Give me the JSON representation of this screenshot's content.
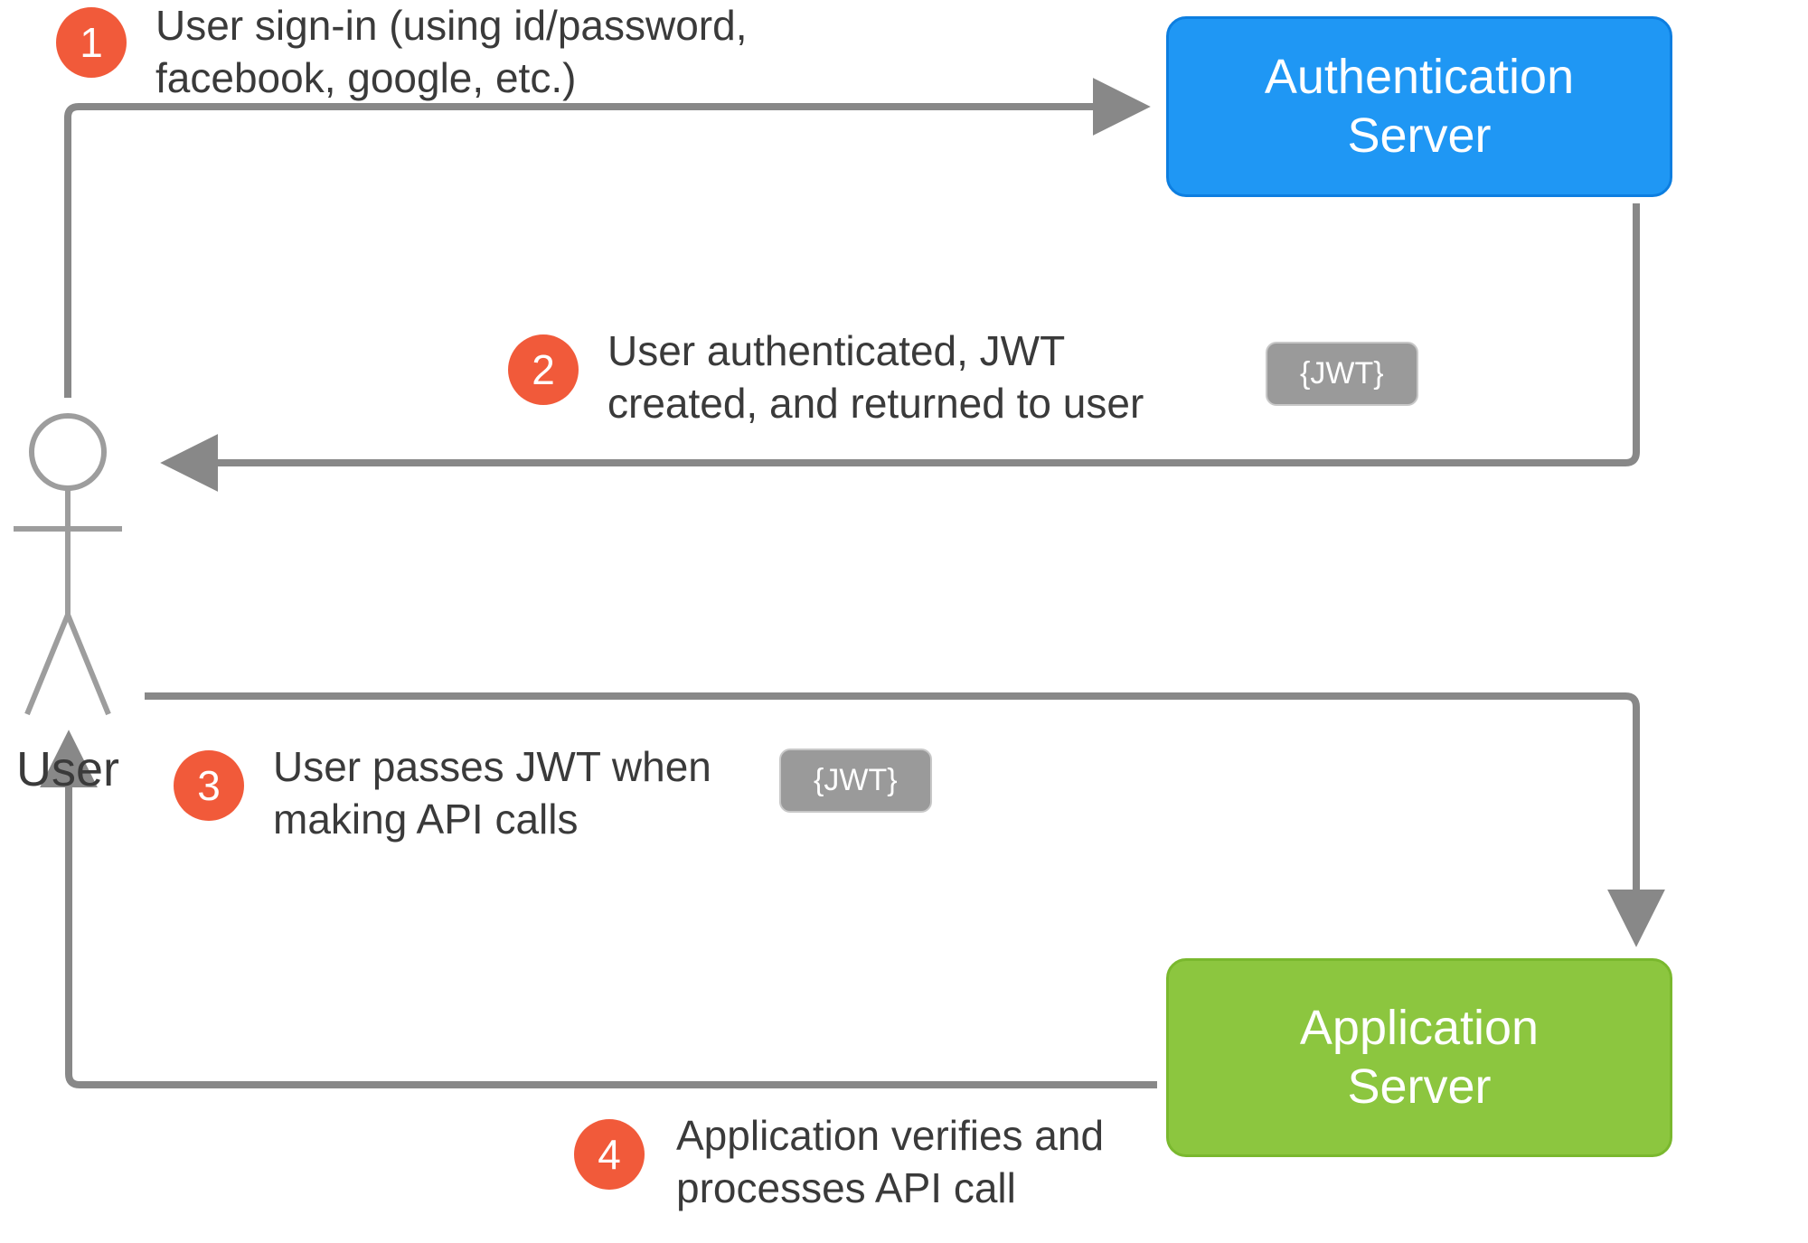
{
  "actors": {
    "user_label": "User"
  },
  "servers": {
    "auth": "Authentication\nServer",
    "app": "Application\nServer"
  },
  "steps": {
    "s1": {
      "num": "1",
      "text": "User sign-in (using id/password,\nfacebook, google, etc.)"
    },
    "s2": {
      "num": "2",
      "text": "User authenticated, JWT\ncreated, and returned to user"
    },
    "s3": {
      "num": "3",
      "text": "User passes JWT when\nmaking API calls"
    },
    "s4": {
      "num": "4",
      "text": "Application verifies and\nprocesses API call"
    }
  },
  "tokens": {
    "jwt_label": "{JWT}"
  },
  "colors": {
    "badge": "#f15a3a",
    "auth_server": "#1f97f4",
    "app_server": "#8cc63f",
    "arrow": "#888888",
    "token_bg": "#9a9a9a"
  }
}
